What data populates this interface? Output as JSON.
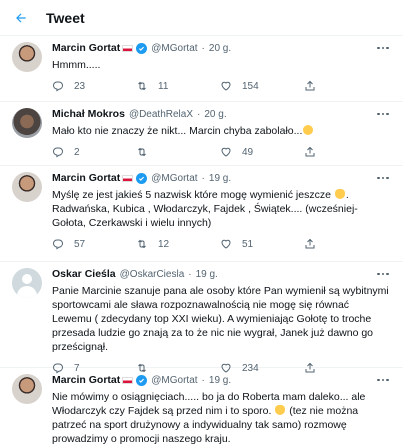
{
  "header": {
    "title": "Tweet"
  },
  "tweets": [
    {
      "name": "Marcin Gortat",
      "handle": "@MGortat",
      "time": "20 g.",
      "text": "Hmmm.....",
      "replies": "23",
      "retweets": "11",
      "likes": "154",
      "avatar": "gortat",
      "flag": true,
      "verified": true
    },
    {
      "name": "Michał Mokros",
      "handle": "@DeathRelaX",
      "time": "20 g.",
      "text": "Mało kto nie znaczy że nikt... Marcin chyba zabolało...",
      "emoji": "winking-face",
      "replies": "2",
      "retweets": "",
      "likes": "49",
      "avatar": "mokros",
      "flag": false,
      "verified": false
    },
    {
      "name": "Marcin Gortat",
      "handle": "@MGortat",
      "time": "19 g.",
      "text_a": "Myślę ze jest jakieś 5 nazwisk które mogę wymienić jeszcze",
      "text_b": ". Radwańska, Kubica , Włodarczyk, Fajdek , Świątek.... (wcześniej-Gołota, Czerkawski i wielu innych)",
      "emoji": "ok-hand",
      "replies": "57",
      "retweets": "12",
      "likes": "51",
      "avatar": "gortat",
      "flag": true,
      "verified": true
    },
    {
      "name": "Oskar Cieśla",
      "handle": "@OskarCiesla",
      "time": "19 g.",
      "text": "Panie Marcinie szanuje pana ale osoby które Pan wymienił są wybitnymi sportowcami ale sława rozpoznawalnością nie mogę się równać Lewemu ( zdecydany top XXI wieku). A wymieniając Gołotę to troche przesada ludzie go znają za to że nic nie wygrał, Janek już dawno go prześcignął.",
      "replies": "7",
      "retweets": "",
      "likes": "234",
      "avatar": "ciesla",
      "flag": false,
      "verified": false
    },
    {
      "name": "Marcin Gortat",
      "handle": "@MGortat",
      "time": "19 g.",
      "text_a": "Nie mówimy o osiągnięciach..... bo ja do Roberta mam daleko... ale Włodarczyk czy Fajdek są przed nim i to sporo.",
      "text_b": "(tez nie można patrzeć na sport drużynowy a indywidualny tak samo) rozmowę prowadzimy o promocji naszego kraju.",
      "emoji": "ok-hand",
      "avatar": "gortat",
      "flag": true,
      "verified": true
    }
  ],
  "icons": {
    "back": "arrow-left-icon",
    "reply": "reply-icon",
    "retweet": "retweet-icon",
    "like": "heart-icon",
    "share": "share-icon",
    "more": "more-icon",
    "verified": "verified-badge-icon"
  },
  "colors": {
    "accent": "#1d9bf0",
    "text": "#0f1419",
    "secondary": "#536471"
  }
}
